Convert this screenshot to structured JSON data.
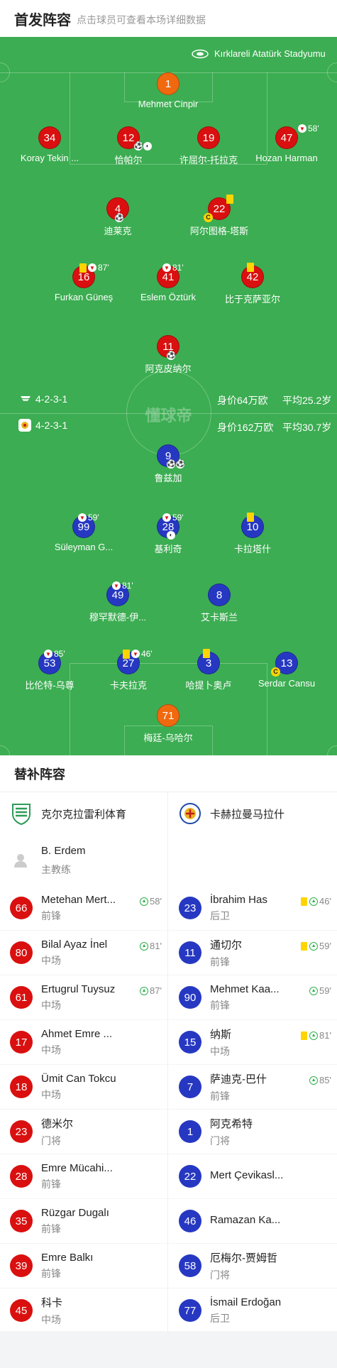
{
  "header": {
    "title": "首发阵容",
    "subtitle": "点击球员可查看本场详细数据"
  },
  "pitch": {
    "stadium": "Kırklareli Atatürk Stadyumu",
    "watermark": "懂球帝",
    "home_formation": "4-2-3-1",
    "away_formation": "4-2-3-1",
    "home_value": "身价64万欧",
    "home_age": "平均25.2岁",
    "away_value": "身价162万欧",
    "away_age": "平均30.7岁"
  },
  "home_players": [
    {
      "num": "1",
      "name": "Mehmet Cinpir"
    },
    {
      "num": "34",
      "name": "Koray Tekin ..."
    },
    {
      "num": "12",
      "name": "恰帕尔"
    },
    {
      "num": "19",
      "name": "许屈尔-托拉克"
    },
    {
      "num": "47",
      "name": "Hozan Harman",
      "sub_min": "58'"
    },
    {
      "num": "4",
      "name": "迪莱克"
    },
    {
      "num": "22",
      "name": "阿尔图格-塔斯"
    },
    {
      "num": "16",
      "name": "Furkan Güneş",
      "sub_min": "87'"
    },
    {
      "num": "41",
      "name": "Eslem Öztürk",
      "sub_min": "81'"
    },
    {
      "num": "42",
      "name": "比于克萨亚尔"
    },
    {
      "num": "11",
      "name": "阿克皮纳尔"
    }
  ],
  "away_players": [
    {
      "num": "9",
      "name": "鲁兹加"
    },
    {
      "num": "99",
      "name": "Süleyman G...",
      "sub_min": "59'"
    },
    {
      "num": "28",
      "name": "基利奇",
      "sub_min": "59'"
    },
    {
      "num": "10",
      "name": "卡拉塔什"
    },
    {
      "num": "49",
      "name": "穆罕默德-伊...",
      "sub_min": "81'"
    },
    {
      "num": "8",
      "name": "艾卡斯兰"
    },
    {
      "num": "53",
      "name": "比伦特-乌尊",
      "sub_min": "85'"
    },
    {
      "num": "27",
      "name": "卡夫拉克",
      "sub_min": "46'"
    },
    {
      "num": "3",
      "name": "哈提卜奥卢"
    },
    {
      "num": "13",
      "name": "Serdar Cansu"
    },
    {
      "num": "71",
      "name": "梅廷-乌哈尔"
    }
  ],
  "subs": {
    "title": "替补阵容",
    "home_team": "克尔克拉雷利体育",
    "away_team": "卡赫拉曼马拉什",
    "coach_name": "B. Erdem",
    "coach_role": "主教练",
    "home": [
      {
        "num": "66",
        "name": "Metehan Mert...",
        "pos": "前锋",
        "min": "58'"
      },
      {
        "num": "80",
        "name": "Bilal Ayaz İnel",
        "pos": "中场",
        "min": "81'"
      },
      {
        "num": "61",
        "name": "Ertugrul Tuysuz",
        "pos": "中场",
        "min": "87'"
      },
      {
        "num": "17",
        "name": "Ahmet Emre ...",
        "pos": "中场"
      },
      {
        "num": "18",
        "name": "Ümit Can Tokcu",
        "pos": "中场"
      },
      {
        "num": "23",
        "name": "德米尔",
        "pos": "门将"
      },
      {
        "num": "28",
        "name": "Emre Mücahi...",
        "pos": "前锋"
      },
      {
        "num": "35",
        "name": "Rüzgar Dugalı",
        "pos": "前锋"
      },
      {
        "num": "39",
        "name": "Emre Balkı",
        "pos": "前锋"
      },
      {
        "num": "45",
        "name": "科卡",
        "pos": "中场"
      }
    ],
    "away": [
      {
        "num": "23",
        "name": "İbrahim Has",
        "pos": "后卫",
        "min": "46'",
        "yc": true
      },
      {
        "num": "11",
        "name": "通切尔",
        "pos": "前锋",
        "min": "59'",
        "yc": true
      },
      {
        "num": "90",
        "name": "Mehmet Kaa...",
        "pos": "前锋",
        "min": "59'"
      },
      {
        "num": "15",
        "name": "纳斯",
        "pos": "中场",
        "min": "81'",
        "yc": true
      },
      {
        "num": "7",
        "name": "萨迪克-巴什",
        "pos": "前锋",
        "min": "85'"
      },
      {
        "num": "1",
        "name": "阿克希特",
        "pos": "门将"
      },
      {
        "num": "22",
        "name": "Mert Çevikasl...",
        "pos": ""
      },
      {
        "num": "46",
        "name": "Ramazan Ka...",
        "pos": ""
      },
      {
        "num": "58",
        "name": "厄梅尔-贾姆哲",
        "pos": "门将"
      },
      {
        "num": "77",
        "name": "İsmail Erdoğan",
        "pos": "后卫"
      }
    ]
  }
}
